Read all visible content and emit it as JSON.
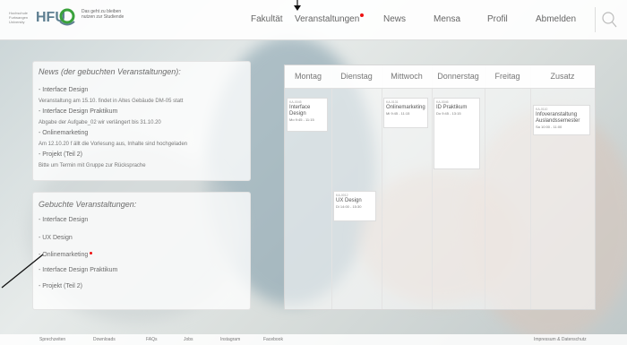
{
  "header": {
    "logo_small": "Hochschule Furtwangen University",
    "logo_text": "HFU",
    "logo_claim": "Das geht zu bleiben nutzen zur Studiende",
    "nav": [
      {
        "label": "Fakultät",
        "badge": false
      },
      {
        "label": "Veranstaltungen",
        "badge": true
      },
      {
        "label": "News",
        "badge": false
      },
      {
        "label": "Mensa",
        "badge": false
      },
      {
        "label": "Profil",
        "badge": false
      },
      {
        "label": "Abmelden",
        "badge": false
      }
    ]
  },
  "news": {
    "title": "News (der gebuchten Veranstaltungen):",
    "lines": [
      {
        "text": "- Interface Design",
        "heading": true
      },
      {
        "text": "Veranstaltung am 15.10. findet in Altes Gebäude DM-05 statt",
        "heading": false
      },
      {
        "text": "- Interface Design Praktikum",
        "heading": true
      },
      {
        "text": "Abgabe der Aufgabe_02 wir verlängert bis 31.10.20",
        "heading": false
      },
      {
        "text": "- Onlinemarketing",
        "heading": true
      },
      {
        "text": "Am 12.10.20 f ällt die Vorlesung aus, Inhalte sind hochgeladen",
        "heading": false
      },
      {
        "text": "- Projekt (Teil 2)",
        "heading": true
      },
      {
        "text": "Bitte um Termin mit Gruppe zur Rücksprache",
        "heading": false
      }
    ]
  },
  "booked": {
    "title": "Gebuchte Veranstaltungen:",
    "items": [
      {
        "label": "- Interface Design",
        "badge": false
      },
      {
        "label": "- UX Design",
        "badge": false
      },
      {
        "label": "- Onlinemarketing",
        "badge": true
      },
      {
        "label": "- Interface Design Praktikum",
        "badge": false
      },
      {
        "label": "- Projekt (Teil 2)",
        "badge": false
      }
    ]
  },
  "calendar": {
    "days": [
      "Montag",
      "Dienstag",
      "Mittwoch",
      "Donnerstag",
      "Freitag",
      "Zusatz"
    ],
    "events": [
      {
        "day": 0,
        "code": "KA-0045",
        "title": "Interface Design",
        "meta": "Mo 9:45 - 11:15"
      },
      {
        "day": 1,
        "code": "KA-0012",
        "title": "UX Design",
        "meta": "Di 14:00 - 15:30"
      },
      {
        "day": 2,
        "code": "KA-0131",
        "title": "Onlinemarketing",
        "meta": "Mi 9:45 - 11:15"
      },
      {
        "day": 3,
        "code": "KA-0046",
        "title": "ID Praktikum",
        "meta": "Do 9:45 - 13:15"
      },
      {
        "day": 5,
        "code": "KA-0110",
        "title": "Infoveranstaltung Auslandssemester",
        "meta": "Sa 10:00 - 11:00"
      }
    ]
  },
  "footer": {
    "links": [
      "Sprechzeiten",
      "Downloads",
      "FAQs",
      "Jobs",
      "Instagram",
      "Facebook"
    ],
    "legal": "Impressum & Datenschutz"
  },
  "colors": {
    "accent": "#5e7f91",
    "badge": "#e11111",
    "logo_green": "#3aa23c"
  }
}
